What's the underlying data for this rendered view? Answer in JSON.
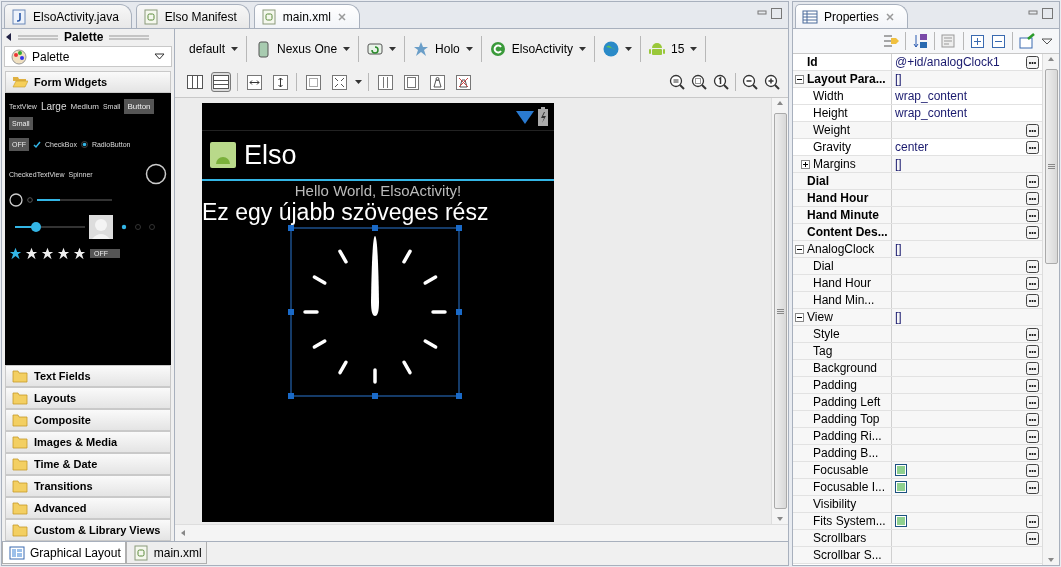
{
  "editor_tabs": [
    {
      "label": "ElsoActivity.java",
      "kind": "java",
      "selected": false
    },
    {
      "label": "Elso Manifest",
      "kind": "manifest",
      "selected": false
    },
    {
      "label": "main.xml",
      "kind": "xml",
      "selected": true
    }
  ],
  "palette": {
    "title": "Palette",
    "selector": "Palette",
    "categories": [
      {
        "label": "Form Widgets",
        "expanded": true
      },
      {
        "label": "Text Fields",
        "expanded": false
      },
      {
        "label": "Layouts",
        "expanded": false
      },
      {
        "label": "Composite",
        "expanded": false
      },
      {
        "label": "Images & Media",
        "expanded": false
      },
      {
        "label": "Time & Date",
        "expanded": false
      },
      {
        "label": "Transitions",
        "expanded": false
      },
      {
        "label": "Advanced",
        "expanded": false
      },
      {
        "label": "Custom & Library Views",
        "expanded": false
      }
    ],
    "preview": {
      "texts": [
        {
          "label": "TextView",
          "kind": "tiny"
        },
        {
          "label": "Large",
          "kind": "large"
        },
        {
          "label": "Medium",
          "kind": "medium"
        },
        {
          "label": "Small",
          "kind": "tiny"
        }
      ],
      "buttons": [
        {
          "label": "Button",
          "kind": "normal"
        },
        {
          "label": "Small",
          "kind": "small"
        }
      ],
      "toggle": {
        "label": "OFF",
        "on": false
      },
      "checkbox": {
        "label": "CheckBox",
        "checked": true
      },
      "radio": {
        "label": "RadioButton",
        "selected": true
      },
      "checked_text": "CheckedTextView",
      "spinner": "Spinner",
      "progress": {
        "level": 0.3
      },
      "seekbar": {
        "level": 0.3
      },
      "radio_dots": [
        {
          "selected": true
        },
        {
          "selected": false
        },
        {
          "selected": false
        }
      ],
      "rating": {
        "stars": 1
      },
      "switch": {
        "label": "OFF",
        "on": false
      }
    }
  },
  "toolbar": [
    {
      "kind": "text",
      "label": "default"
    },
    {
      "kind": "device",
      "label": "Nexus One"
    },
    {
      "kind": "orientation"
    },
    {
      "kind": "theme",
      "label": "Holo"
    },
    {
      "kind": "activity",
      "label": "ElsoActivity"
    },
    {
      "kind": "locale"
    },
    {
      "kind": "api",
      "label": "15"
    }
  ],
  "layout_toggles": [
    {
      "selected": false
    },
    {
      "selected": true
    }
  ],
  "phone": {
    "app_title": "Elso",
    "hello": "Hello World, ElsoActivity!",
    "text": "Ez egy újabb szöveges rész"
  },
  "bottom_tabs": [
    {
      "label": "Graphical Layout",
      "kind": "layout",
      "selected": true
    },
    {
      "label": "main.xml",
      "kind": "xml",
      "selected": false
    }
  ],
  "properties": {
    "title": "Properties",
    "rows": [
      {
        "name": "Id",
        "bold": true,
        "value": "@+id/analogClock1",
        "button": true
      },
      {
        "name": "Layout Para...",
        "bold": true,
        "value": "[]",
        "expanded": true,
        "children": [
          {
            "name": "Width",
            "value": "wrap_content"
          },
          {
            "name": "Height",
            "value": "wrap_content"
          },
          {
            "name": "Weight",
            "button": true
          },
          {
            "name": "Gravity",
            "value": "center",
            "button": true
          },
          {
            "name": "Margins",
            "value": "[]",
            "expanded": false
          }
        ]
      },
      {
        "name": "Dial",
        "bold": true,
        "button": true
      },
      {
        "name": "Hand Hour",
        "bold": true,
        "button": true
      },
      {
        "name": "Hand Minute",
        "bold": true,
        "button": true
      },
      {
        "name": "Content Des...",
        "bold": true,
        "button": true
      },
      {
        "name": "AnalogClock",
        "value": "[]",
        "expanded": true,
        "children": [
          {
            "name": "Dial",
            "button": true
          },
          {
            "name": "Hand Hour",
            "button": true
          },
          {
            "name": "Hand Min...",
            "button": true
          }
        ]
      },
      {
        "name": "View",
        "value": "[]",
        "expanded": true,
        "children": [
          {
            "name": "Style",
            "button": true
          },
          {
            "name": "Tag",
            "button": true
          },
          {
            "name": "Background",
            "button": true
          },
          {
            "name": "Padding",
            "button": true
          },
          {
            "name": "Padding Left",
            "button": true
          },
          {
            "name": "Padding Top",
            "button": true
          },
          {
            "name": "Padding Ri...",
            "button": true
          },
          {
            "name": "Padding B...",
            "button": true
          },
          {
            "name": "Focusable",
            "mixed": true,
            "button": true
          },
          {
            "name": "Focusable I...",
            "mixed": true,
            "button": true
          },
          {
            "name": "Visibility"
          },
          {
            "name": "Fits System...",
            "mixed": true,
            "button": true
          },
          {
            "name": "Scrollbars",
            "button": true
          },
          {
            "name": "Scrollbar S..."
          }
        ]
      }
    ]
  }
}
